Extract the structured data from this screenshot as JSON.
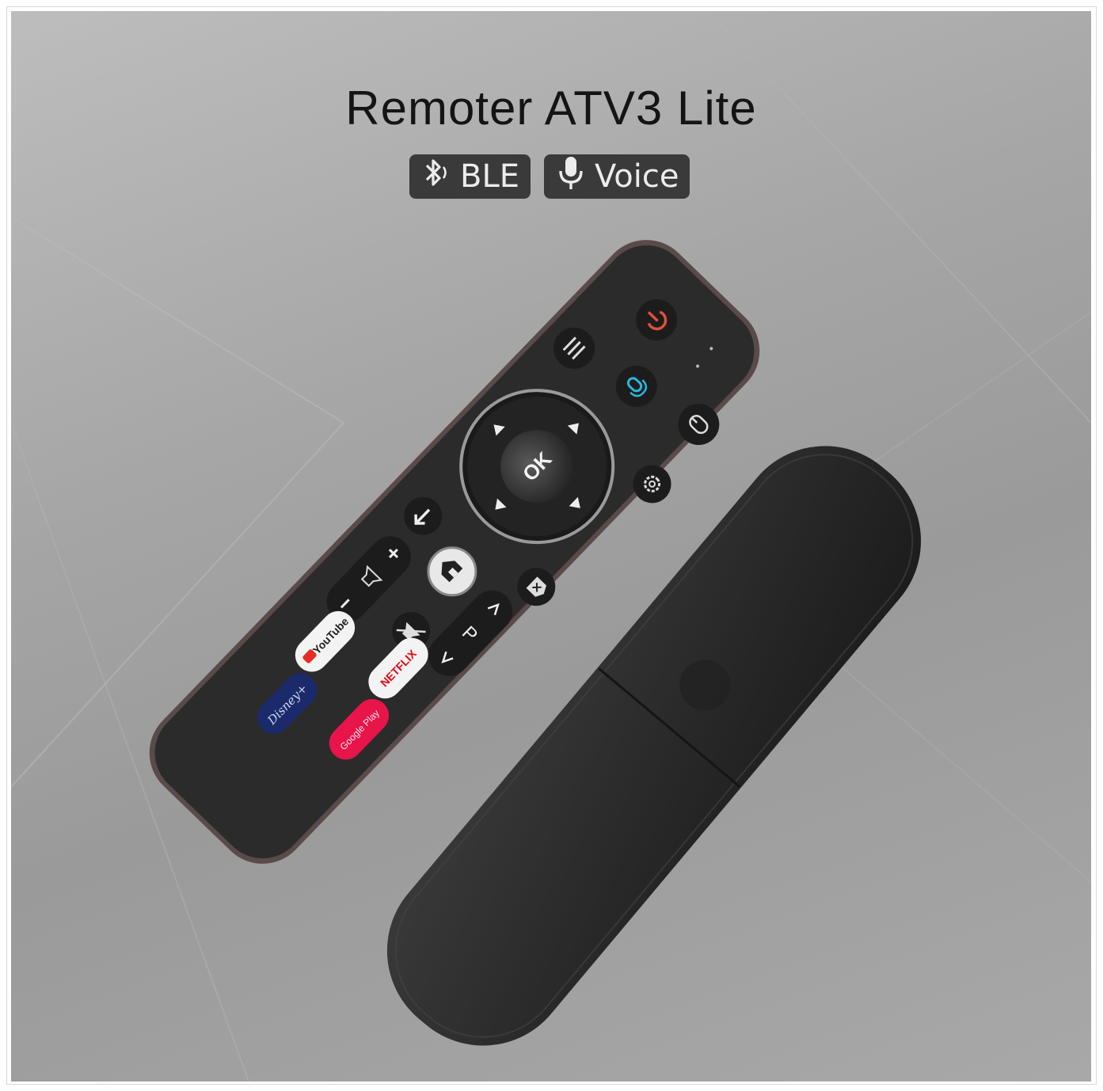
{
  "title": "Remoter ATV3 Lite",
  "badges": [
    {
      "label": "BLE",
      "icon": "bluetooth-icon"
    },
    {
      "label": "Voice",
      "icon": "microphone-icon"
    }
  ],
  "remote": {
    "ok_label": "OK",
    "program_label": "P",
    "apps": [
      "YouTube",
      "NETFLIX",
      "Disney+",
      "Google Play"
    ]
  },
  "colors": {
    "background": "#a6a6a6",
    "remote_body": "#2b2b2b",
    "power": "#e0503a",
    "voice": "#2bb6d9",
    "netflix": "#e50914",
    "google_play": "#e8144a",
    "disney": "#1a2a6b"
  }
}
